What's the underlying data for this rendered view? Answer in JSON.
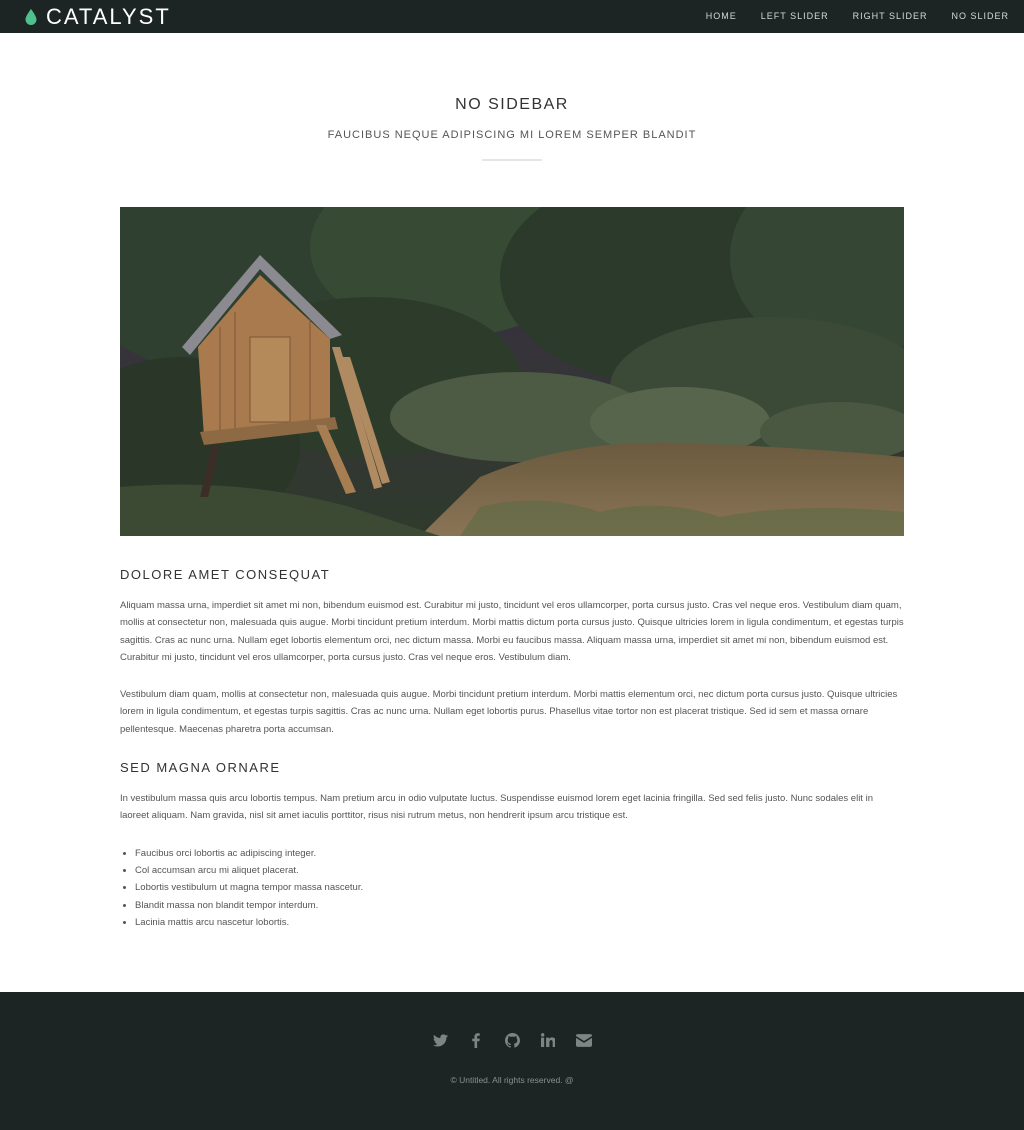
{
  "header": {
    "brand": "CATALYST",
    "nav": [
      "HOME",
      "LEFT SLIDER",
      "RIGHT SLIDER",
      "NO SLIDER"
    ]
  },
  "page": {
    "title": "NO SIDEBAR",
    "subtitle": "FAUCIBUS NEQUE ADIPISCING MI LOREM SEMPER BLANDIT"
  },
  "article": {
    "heading1": "DOLORE AMET CONSEQUAT",
    "para1": "Aliquam massa urna, imperdiet sit amet mi non, bibendum euismod est. Curabitur mi justo, tincidunt vel eros ullamcorper, porta cursus justo. Cras vel neque eros. Vestibulum diam quam, mollis at consectetur non, malesuada quis augue. Morbi tincidunt pretium interdum. Morbi mattis dictum porta cursus justo. Quisque ultricies lorem in ligula condimentum, et egestas turpis sagittis. Cras ac nunc urna. Nullam eget lobortis elementum orci, nec dictum massa. Morbi eu faucibus massa. Aliquam massa urna, imperdiet sit amet mi non, bibendum euismod est. Curabitur mi justo, tincidunt vel eros ullamcorper, porta cursus justo. Cras vel neque eros. Vestibulum diam.",
    "para2": "Vestibulum diam quam, mollis at consectetur non, malesuada quis augue. Morbi tincidunt pretium interdum. Morbi mattis elementum orci, nec dictum porta cursus justo. Quisque ultricies lorem in ligula condimentum, et egestas turpis sagittis. Cras ac nunc urna. Nullam eget lobortis purus. Phasellus vitae tortor non est placerat tristique. Sed id sem et massa ornare pellentesque. Maecenas pharetra porta accumsan.",
    "heading2": "SED MAGNA ORNARE",
    "para3": "In vestibulum massa quis arcu lobortis tempus. Nam pretium arcu in odio vulputate luctus. Suspendisse euismod lorem eget lacinia fringilla. Sed sed felis justo. Nunc sodales elit in laoreet aliquam. Nam gravida, nisl sit amet iaculis porttitor, risus nisi rutrum metus, non hendrerit ipsum arcu tristique est.",
    "bullets": [
      "Faucibus orci lobortis ac adipiscing integer.",
      "Col accumsan arcu mi aliquet placerat.",
      "Lobortis vestibulum ut magna tempor massa nascetur.",
      "Blandit massa non blandit tempor interdum.",
      "Lacinia mattis arcu nascetur lobortis."
    ]
  },
  "footer": {
    "social_icons": [
      "twitter-icon",
      "facebook-icon",
      "github-icon",
      "linkedin-icon",
      "envelope-icon"
    ],
    "copyright": "© Untitled. All rights reserved. @"
  },
  "colors": {
    "header_bg": "#1d2424",
    "brand_accent": "#4fc08d",
    "footer_icon": "#7c8484"
  }
}
